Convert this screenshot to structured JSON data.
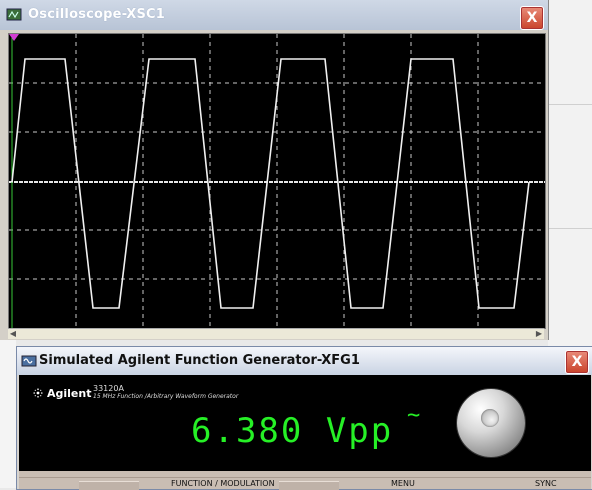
{
  "oscilloscope": {
    "title": "Oscilloscope-XSC1",
    "close_label": "X"
  },
  "function_generator": {
    "title": "Simulated Agilent Function Generator-XFG1",
    "close_label": "X",
    "brand": "Agilent",
    "model_number": "33120A",
    "model_description": "15 MHz Function /Arbitrary Waveform Generator",
    "readout": "6.380 Vpp",
    "waveform_symbol": "~",
    "labels": {
      "function_modulation": "FUNCTION / MODULATION",
      "menu": "MENU",
      "sync": "SYNC"
    }
  },
  "colors": {
    "trace": "#f0f0f0",
    "grid": "#c8c8c8",
    "readout": "#26f026",
    "screen_bg": "#000000"
  }
}
